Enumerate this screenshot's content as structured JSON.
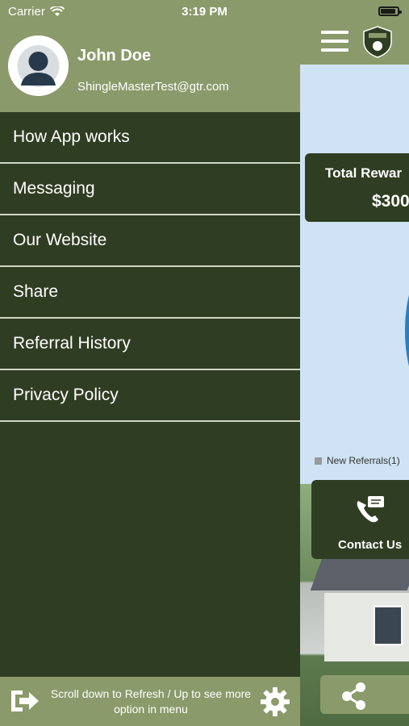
{
  "status_bar": {
    "carrier": "Carrier",
    "time": "3:19 PM"
  },
  "user": {
    "name": "John Doe",
    "email": "ShingleMasterTest@gtr.com"
  },
  "menu": {
    "items": [
      {
        "label": "How App works"
      },
      {
        "label": "Messaging"
      },
      {
        "label": "Our Website"
      },
      {
        "label": "Share"
      },
      {
        "label": "Referral History"
      },
      {
        "label": "Privacy Policy"
      }
    ]
  },
  "footer": {
    "hint": "Scroll down to Refresh / Up to see more option in menu"
  },
  "background_app": {
    "rewards_title": "Total Rewar",
    "rewards_value": "$300",
    "legend_label": "New Referrals(1)",
    "contact_label": "Contact Us"
  },
  "colors": {
    "header_green": "#8a9a6a",
    "drawer_dark": "#2f3d22",
    "chart_blue": "#2a7fc4"
  },
  "icons": [
    "wifi-icon",
    "battery-icon",
    "hamburger-icon",
    "logo-icon",
    "avatar-icon",
    "logout-icon",
    "gear-icon",
    "phone-chat-icon",
    "share-icon"
  ]
}
